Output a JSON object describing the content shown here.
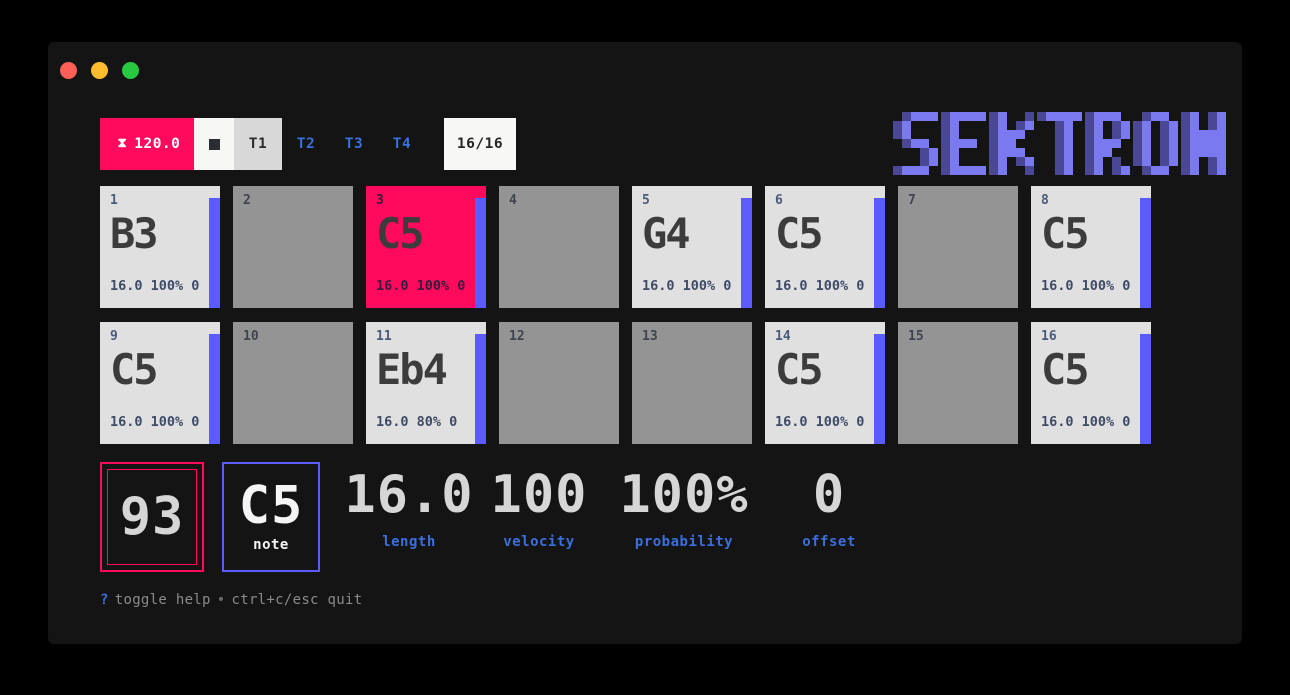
{
  "window": {
    "lights": [
      "close",
      "minimize",
      "zoom"
    ]
  },
  "toolbar": {
    "tempo_icon": "metronome-icon",
    "tempo_glyph": "⧗",
    "tempo": "120.0",
    "stop_icon": "stop-square-icon",
    "tracks": [
      {
        "label": "T1",
        "active": true
      },
      {
        "label": "T2",
        "active": false
      },
      {
        "label": "T3",
        "active": false
      },
      {
        "label": "T4",
        "active": false
      }
    ],
    "pattern": "16/16"
  },
  "logo": {
    "text": "SEKTRON",
    "color": "#7b79ef",
    "shadow_color": "#4a4894"
  },
  "grid": {
    "rows": [
      [
        {
          "index": "1",
          "note": "B3",
          "meta": "16.0 100% 0",
          "state": "filled"
        },
        {
          "index": "2",
          "note": "",
          "meta": "",
          "state": "empty"
        },
        {
          "index": "3",
          "note": "C5",
          "meta": "16.0 100% 0",
          "state": "active"
        },
        {
          "index": "4",
          "note": "",
          "meta": "",
          "state": "empty"
        },
        {
          "index": "5",
          "note": "G4",
          "meta": "16.0 100% 0",
          "state": "filled"
        },
        {
          "index": "6",
          "note": "C5",
          "meta": "16.0 100% 0",
          "state": "filled"
        },
        {
          "index": "7",
          "note": "",
          "meta": "",
          "state": "empty"
        },
        {
          "index": "8",
          "note": "C5",
          "meta": "16.0 100% 0",
          "state": "filled"
        }
      ],
      [
        {
          "index": "9",
          "note": "C5",
          "meta": "16.0 100% 0",
          "state": "filled"
        },
        {
          "index": "10",
          "note": "",
          "meta": "",
          "state": "empty"
        },
        {
          "index": "11",
          "note": "Eb4",
          "meta": "16.0 80% 0",
          "state": "filled"
        },
        {
          "index": "12",
          "note": "",
          "meta": "",
          "state": "empty"
        },
        {
          "index": "13",
          "note": "",
          "meta": "",
          "state": "empty"
        },
        {
          "index": "14",
          "note": "C5",
          "meta": "16.0 100% 0",
          "state": "filled"
        },
        {
          "index": "15",
          "note": "",
          "meta": "",
          "state": "empty"
        },
        {
          "index": "16",
          "note": "C5",
          "meta": "16.0 100% 0",
          "state": "filled"
        }
      ]
    ]
  },
  "params": {
    "chord": {
      "value": "93",
      "label": ""
    },
    "note": {
      "value": "C5",
      "label": "note"
    },
    "length": {
      "value": "16.0",
      "label": "length"
    },
    "velocity": {
      "value": "100",
      "label": "velocity"
    },
    "probability": {
      "value": "100%",
      "label": "probability"
    },
    "offset": {
      "value": "0",
      "label": "offset"
    }
  },
  "footer": {
    "help_key": "?",
    "help_text": "toggle help",
    "separator": "•",
    "quit_text": "ctrl+c/esc quit"
  },
  "colors": {
    "accent_pink": "#ff0a5c",
    "accent_blue": "#5b5bff",
    "label_blue": "#3a6fdd",
    "cell_filled": "#e0e0e0",
    "cell_empty": "#949494",
    "background": "#141414"
  }
}
